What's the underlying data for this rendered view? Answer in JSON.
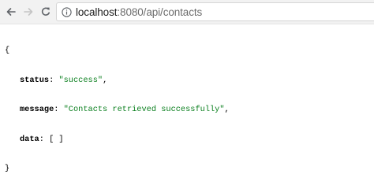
{
  "browser": {
    "address_bar": {
      "host": "localhost",
      "rest": ":8080/api/contacts"
    }
  },
  "json_view": {
    "open_brace": "{",
    "close_brace": "}",
    "entries": [
      {
        "key": "status",
        "value": "\"success\"",
        "suffix": ","
      },
      {
        "key": "message",
        "value": "\"Contacts retrieved successfully\"",
        "suffix": ","
      },
      {
        "key": "data",
        "value": "[ ]",
        "suffix": ""
      }
    ]
  },
  "colors": {
    "string_value": "#0a7f1e",
    "toolbar_bg": "#f2f2f2"
  }
}
